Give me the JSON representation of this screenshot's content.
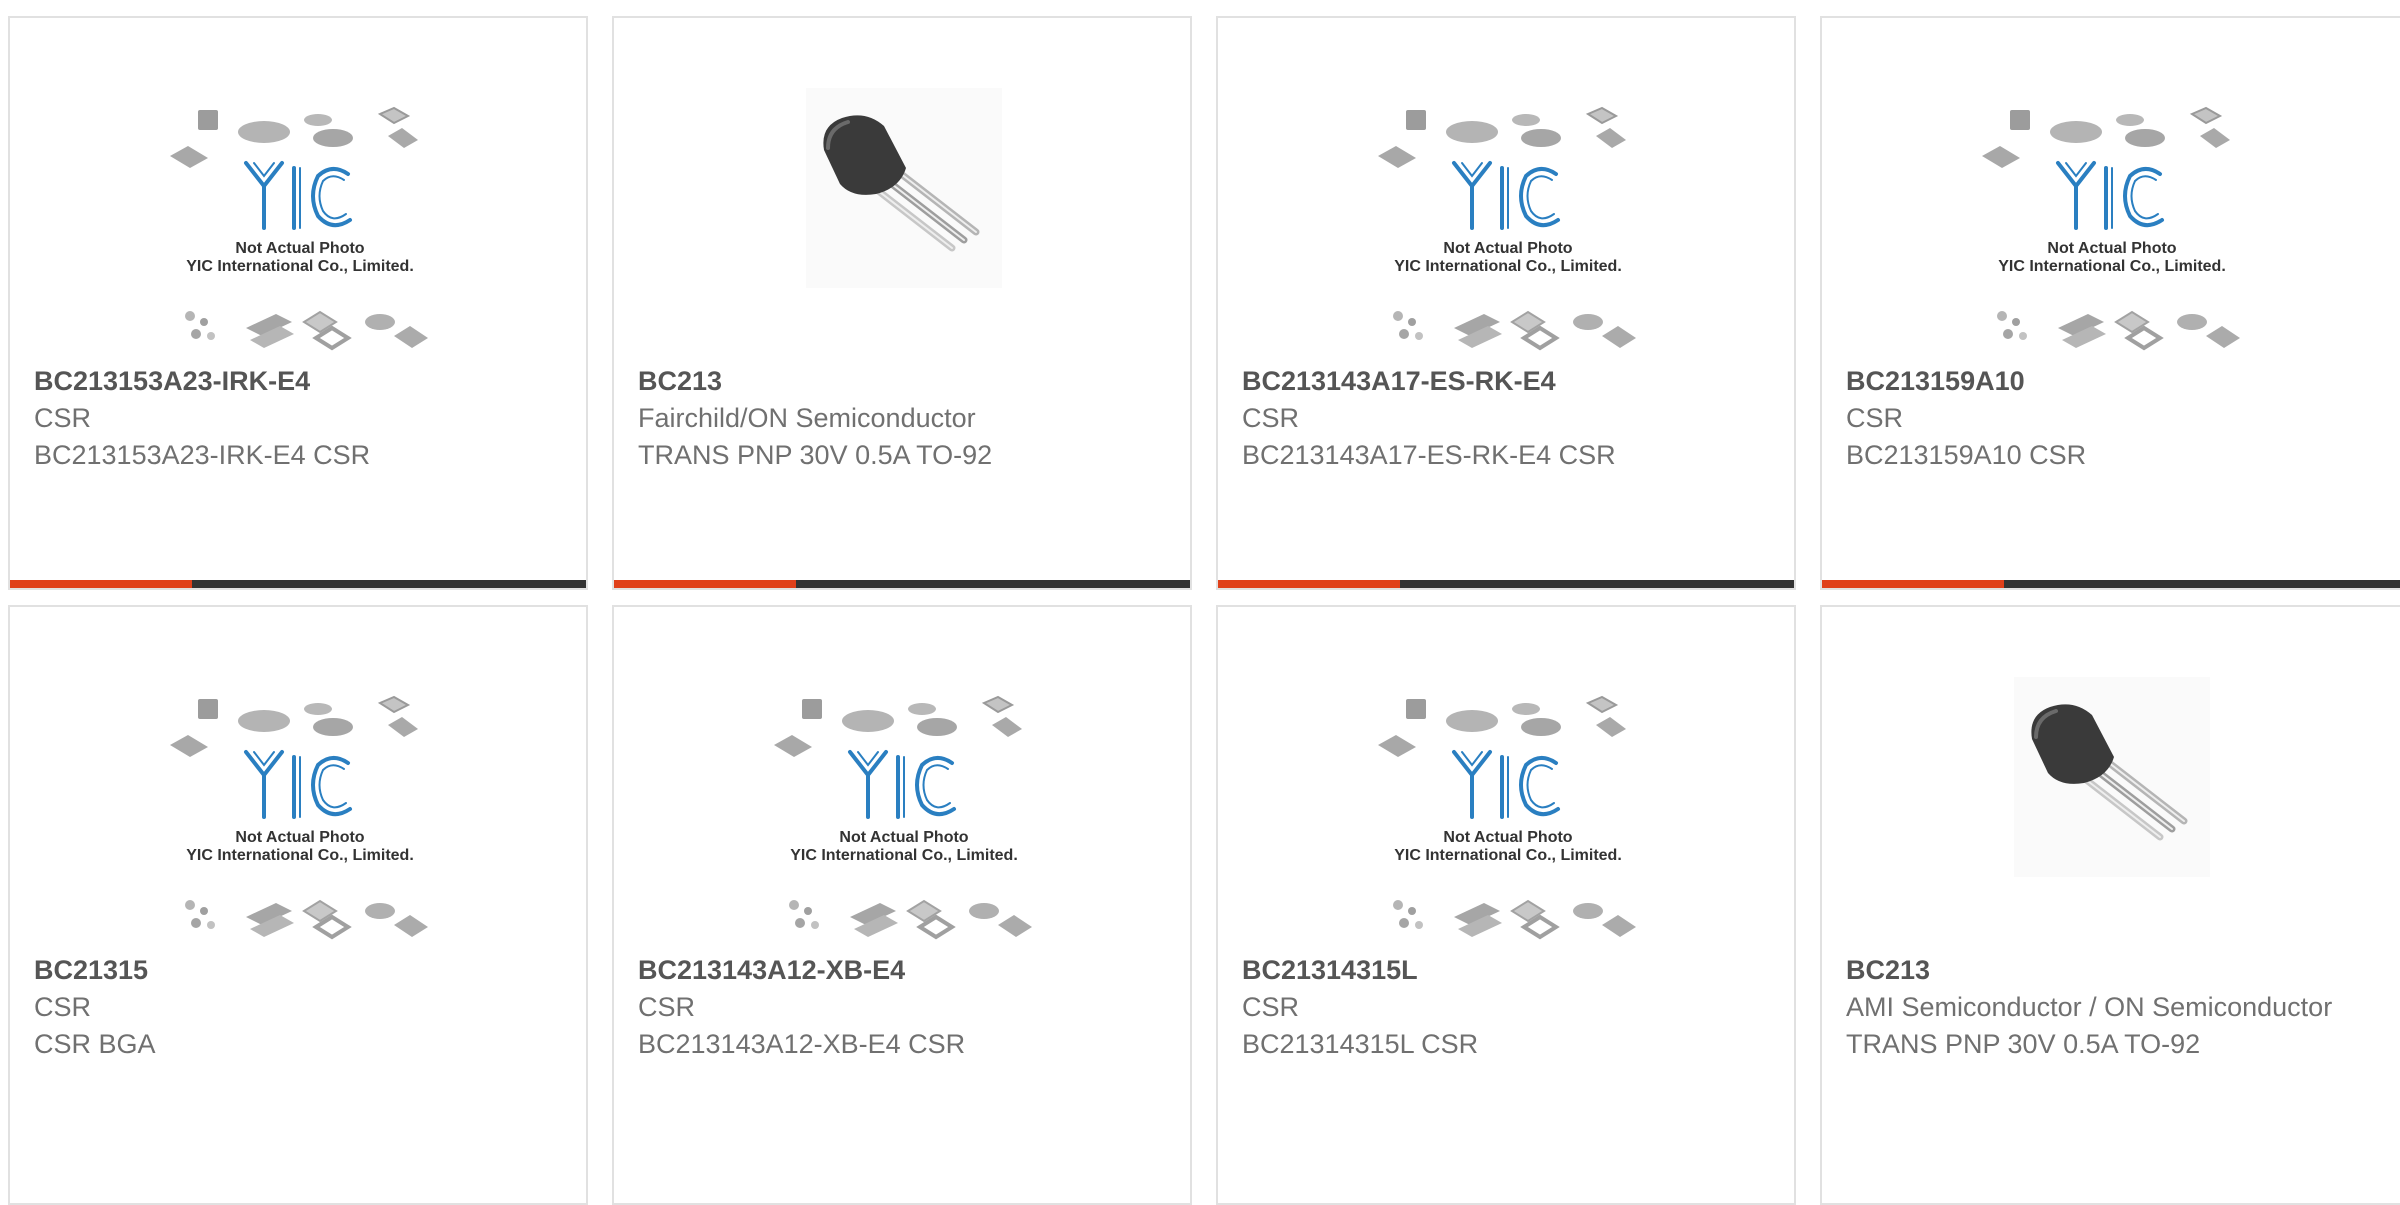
{
  "colors": {
    "accent": "#e0401a",
    "bar_dark": "#333333",
    "yic_blue": "#2a7fc1",
    "text_title": "#555555",
    "text_body": "#707070"
  },
  "placeholder": {
    "line1": "Not Actual Photo",
    "line2": "YIC International Co., Limited.",
    "logo_icon": "yic-logo-icon"
  },
  "cards": [
    {
      "part": "BC213153A23-IRK-E4",
      "manufacturer": "CSR",
      "description": "BC213153A23-IRK-E4 CSR",
      "image": "placeholder"
    },
    {
      "part": "BC213",
      "manufacturer": "Fairchild/ON Semiconductor",
      "description": "TRANS PNP 30V 0.5A TO-92",
      "image": "transistor"
    },
    {
      "part": "BC213143A17-ES-RK-E4",
      "manufacturer": "CSR",
      "description": "BC213143A17-ES-RK-E4 CSR",
      "image": "placeholder"
    },
    {
      "part": "BC213159A10",
      "manufacturer": "CSR",
      "description": "BC213159A10 CSR",
      "image": "placeholder"
    },
    {
      "part": "BC21315",
      "manufacturer": "CSR",
      "description": "CSR BGA",
      "image": "placeholder"
    },
    {
      "part": "BC213143A12-XB-E4",
      "manufacturer": "CSR",
      "description": "BC213143A12-XB-E4 CSR",
      "image": "placeholder"
    },
    {
      "part": "BC21314315L",
      "manufacturer": "CSR",
      "description": "BC21314315L CSR",
      "image": "placeholder"
    },
    {
      "part": "BC213",
      "manufacturer": "AMI Semiconductor / ON Semiconductor",
      "description": "TRANS PNP 30V 0.5A TO-92",
      "image": "transistor"
    }
  ]
}
